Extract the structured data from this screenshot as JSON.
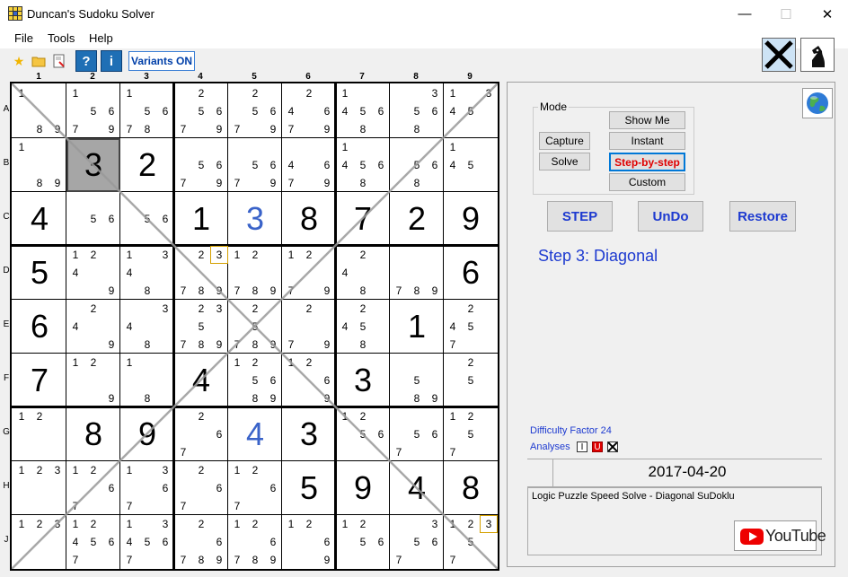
{
  "window": {
    "title": "Duncan's Sudoku Solver",
    "min": "—",
    "max": "☐",
    "close": "✕"
  },
  "menu": [
    {
      "label": "File"
    },
    {
      "label": "Tools"
    },
    {
      "label": "Help"
    }
  ],
  "toolbar": {
    "help_label": "?",
    "info_label": "i",
    "variants_label": "Variants ON"
  },
  "column_labels": [
    "1",
    "2",
    "3",
    "4",
    "5",
    "6",
    "7",
    "8",
    "9"
  ],
  "row_labels": [
    "A",
    "B",
    "C",
    "D",
    "E",
    "F",
    "G",
    "H",
    "J"
  ],
  "grid": [
    [
      "c:1 8 9",
      "c:1 5 6 7 9",
      "c:1 5 6 7 8",
      "c:2 5 6 7 9",
      "c:2 5 6 7 9",
      "c:2 4 6 7 9",
      "c:1 4 5 6 8",
      "c:3 5 6 8",
      "c:1 3 4 5"
    ],
    [
      "c:1 8 9",
      "g:3",
      "g:2",
      "c:5 6 7 9",
      "c:5 6 7 9",
      "c:4 6 7 9",
      "c:1 4 5 6 8",
      "c:5 6 8",
      "c:1 4 5"
    ],
    [
      "g:4",
      "c:5 6",
      "c:5 6",
      "g:1",
      "s:3",
      "g:8",
      "g:7",
      "g:2",
      "g:9"
    ],
    [
      "g:5",
      "c:1 2 4 9",
      "c:1 3 4 8",
      "c:2 3 7 8 9",
      "c:1 2 7 8 9",
      "c:1 2 7 9",
      "c:2 4 8",
      "c:7 8 9",
      "g:6"
    ],
    [
      "g:6",
      "c:2 4 9",
      "c:3 4 8",
      "c:2 3 5 7 8 9",
      "c:2 5 7 8 9",
      "c:2 7 9",
      "c:2 4 5 8",
      "g:1",
      "c:2 4 5 7"
    ],
    [
      "g:7",
      "c:1 2 9",
      "c:1 8",
      "g:4",
      "c:1 2 5 6 8 9",
      "c:1 2 6 9",
      "g:3",
      "c:5 8 9",
      "c:2 5"
    ],
    [
      "c:1 2",
      "g:8",
      "g:9",
      "c:2 6 7",
      "s:4",
      "g:3",
      "c:1 2 5 6",
      "c:5 6 7",
      "c:1 2 5 7"
    ],
    [
      "c:1 2 3",
      "c:1 2 6 7",
      "c:1 3 6 7",
      "c:2 6 7",
      "c:1 2 6 7",
      "g:5",
      "g:9",
      "g:4",
      "g:8"
    ],
    [
      "c:1 2 3",
      "c:1 2 4 5 6 7",
      "c:1 3 4 5 6 7",
      "c:2 6 7 8 9",
      "c:1 2 6 7 8 9",
      "c:1 2 6 9",
      "c:1 2 5 6",
      "c:3 5 6 7",
      "c:1 2 3 5 7"
    ]
  ],
  "selected_cell": [
    1,
    1
  ],
  "highlight": [
    {
      "r": 3,
      "c": 3,
      "v": "3"
    },
    {
      "r": 8,
      "c": 8,
      "v": "3"
    }
  ],
  "panel": {
    "mode_label": "Mode",
    "show_me": "Show Me",
    "instant": "Instant",
    "step_by_step": "Step-by-step",
    "custom": "Custom",
    "capture": "Capture",
    "solve": "Solve",
    "step_btn": "STEP",
    "undo_btn": "UnDo",
    "restore_btn": "Restore",
    "step_text": "Step 3: Diagonal",
    "difficulty": "Difficulty Factor 24",
    "analyses": "Analyses",
    "analysis_i": "I",
    "analysis_u": "U",
    "date": "2017-04-20",
    "description": "Logic Puzzle Speed Solve - Diagonal SuDoklu",
    "youtube": "YouTube"
  },
  "colors": {
    "accent_blue": "#1d3ad0",
    "solved_blue": "#3a63c9",
    "active_red": "#e00000",
    "selected_gray": "#a6a6a6"
  }
}
